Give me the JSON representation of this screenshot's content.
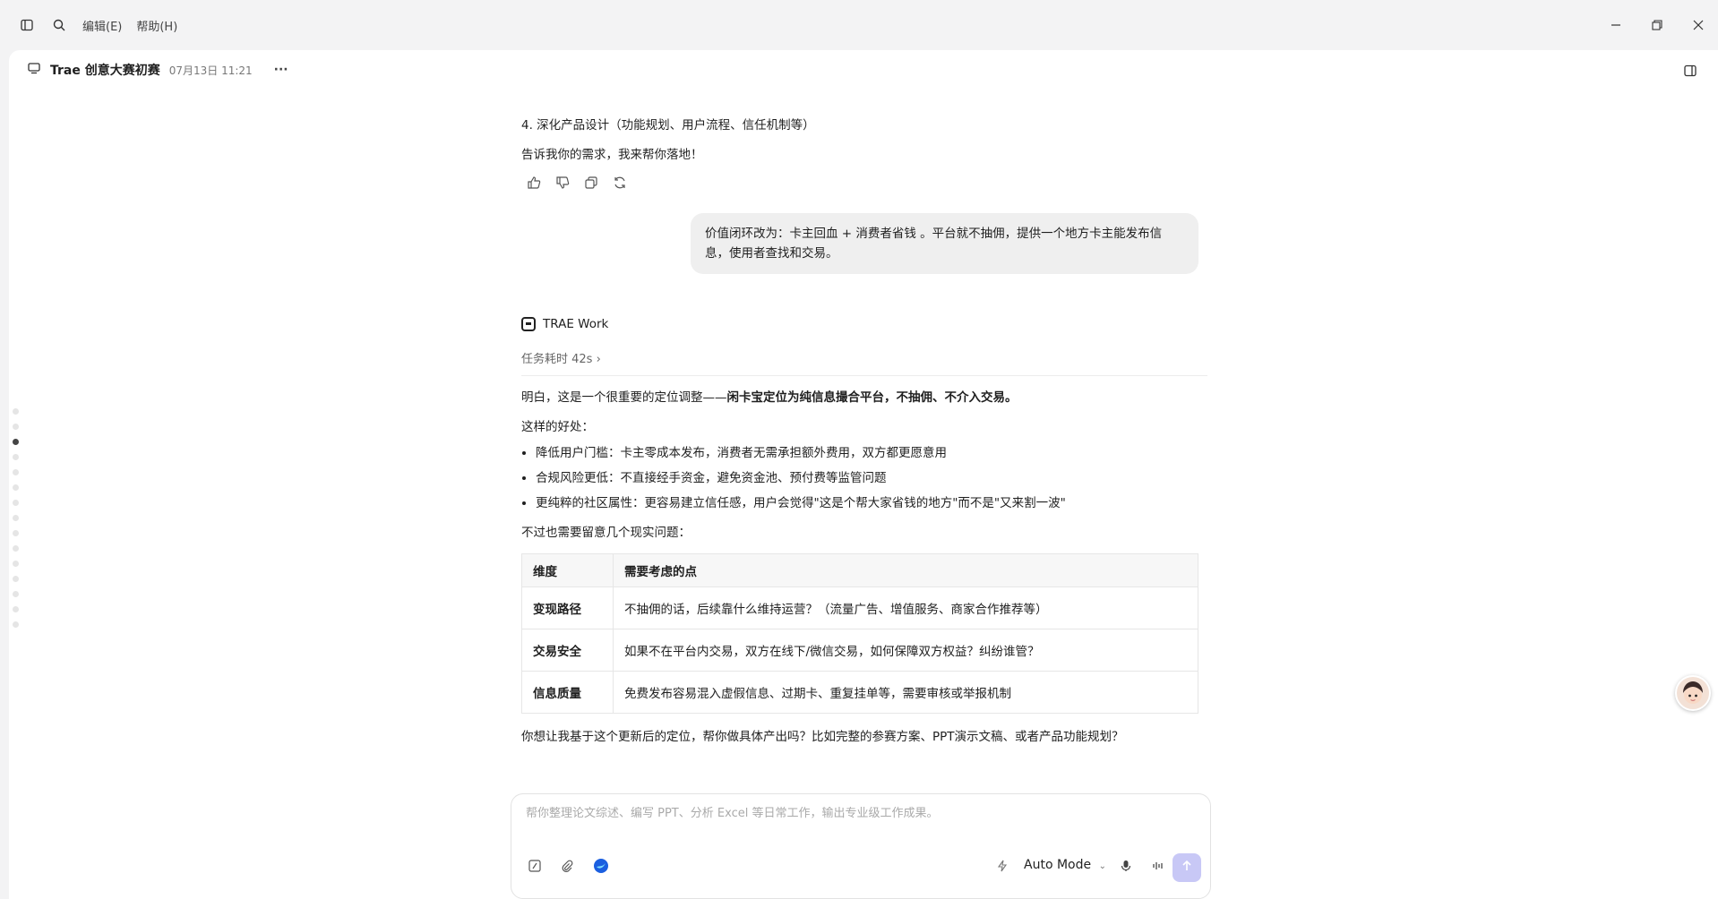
{
  "menu": {
    "edit": "编辑(E)",
    "help": "帮助(H)"
  },
  "header": {
    "title": "Trae 创意大赛初赛",
    "time": "07月13日 11:21",
    "more": "···"
  },
  "prev": {
    "item4": "4. 深化产品设计（功能规划、用户流程、信任机制等）",
    "cta": "告诉我你的需求，我来帮你落地！"
  },
  "user_message": "价值闭环改为：卡主回血 + 消费者省钱 。平台就不抽佣，提供一个地方卡主能发布信息，使用者查找和交易。",
  "bot": {
    "name": "TRAE Work",
    "task": "任务耗时 42s ›",
    "intro_pre": "明白，这是一个很重要的定位调整——",
    "intro_bold": "闲卡宝定位为纯信息撮合平台，不抽佣、不介入交易。",
    "benefits_title": "这样的好处：",
    "benefits": [
      "降低用户门槛：卡主零成本发布，消费者无需承担额外费用，双方都更愿意用",
      "合规风险更低：不直接经手资金，避免资金池、预付费等监管问题",
      "更纯粹的社区属性：更容易建立信任感，用户会觉得\"这是个帮大家省钱的地方\"而不是\"又来割一波\""
    ],
    "issues_title": "不过也需要留意几个现实问题：",
    "table": {
      "headers": [
        "维度",
        "需要考虑的点"
      ],
      "rows": [
        [
          "变现路径",
          "不抽佣的话，后续靠什么维持运营？（流量广告、增值服务、商家合作推荐等）"
        ],
        [
          "交易安全",
          "如果不在平台内交易，双方在线下/微信交易，如何保障双方权益？纠纷谁管？"
        ],
        [
          "信息质量",
          "免费发布容易混入虚假信息、过期卡、重复挂单等，需要审核或举报机制"
        ]
      ]
    },
    "followup": "你想让我基于这个更新后的定位，帮你做具体产出吗？比如完整的参赛方案、PPT演示文稿、或者产品功能规划？"
  },
  "composer": {
    "placeholder": "帮你整理论文综述、编写 PPT、分析 Excel 等日常工作，输出专业级工作成果。",
    "mode": "Auto Mode"
  }
}
